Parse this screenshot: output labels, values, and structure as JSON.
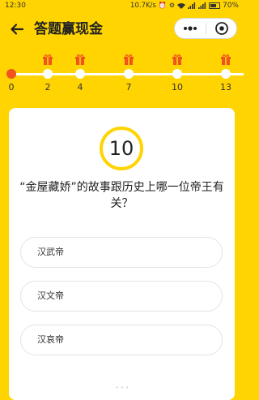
{
  "status_bar": {
    "time": "12:30",
    "speed": "10.7K/s",
    "battery": "70%",
    "battery_level": 0.7
  },
  "nav": {
    "title": "答题赢现金"
  },
  "progress": {
    "milestones": [
      "0",
      "2",
      "4",
      "7",
      "10",
      "13"
    ],
    "current_index": 0,
    "gift_milestones": [
      "2",
      "4",
      "7",
      "10",
      "13"
    ],
    "accent": "#F0551F"
  },
  "quiz": {
    "timer": "10",
    "question": "“金屋藏娇”的故事跟历史上哪一位帝王有关？",
    "options": [
      "汉武帝",
      "汉文帝",
      "汉哀帝"
    ]
  },
  "colors": {
    "background": "#FFD400",
    "card": "#FFFFFF"
  }
}
